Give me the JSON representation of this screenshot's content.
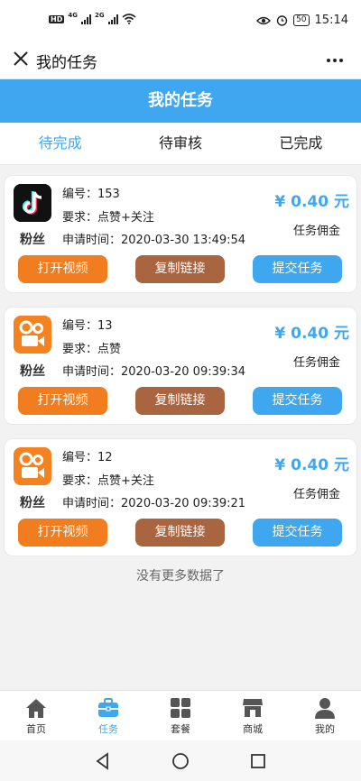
{
  "status_bar": {
    "left_badge": "HD",
    "sig1_label": "4G",
    "sig2_label": "2G",
    "battery": "50",
    "time": "15:14"
  },
  "app_header": {
    "title": "我的任务"
  },
  "page": {
    "title": "我的任务"
  },
  "tabs": [
    {
      "label": "待完成",
      "active": true
    },
    {
      "label": "待审核",
      "active": false
    },
    {
      "label": "已完成",
      "active": false
    }
  ],
  "tasks": [
    {
      "platform_label": "粉丝",
      "platform_icon": "tiktok-logo-icon",
      "number_label": "编号：153",
      "requirement_label": "要求：点赞+关注",
      "applied_label": "申请时间：2020-03-30 13:49:54",
      "price": "¥ 0.40 元",
      "commission_label": "任务佣金",
      "buttons": {
        "open": "打开视频",
        "copy": "复制链接",
        "submit": "提交任务"
      }
    },
    {
      "platform_label": "粉丝",
      "platform_icon": "kuaishou-logo-icon",
      "number_label": "编号：13",
      "requirement_label": "要求：点赞",
      "applied_label": "申请时间：2020-03-20 09:39:34",
      "price": "¥ 0.40 元",
      "commission_label": "任务佣金",
      "buttons": {
        "open": "打开视频",
        "copy": "复制链接",
        "submit": "提交任务"
      }
    },
    {
      "platform_label": "粉丝",
      "platform_icon": "kuaishou-logo-icon",
      "number_label": "编号：12",
      "requirement_label": "要求：点赞+关注",
      "applied_label": "申请时间：2020-03-20 09:39:21",
      "price": "¥ 0.40 元",
      "commission_label": "任务佣金",
      "buttons": {
        "open": "打开视频",
        "copy": "复制链接",
        "submit": "提交任务"
      }
    }
  ],
  "no_more": "没有更多数据了",
  "bottom_nav": [
    {
      "label": "首页",
      "icon": "home-icon",
      "active": false
    },
    {
      "label": "任务",
      "icon": "briefcase-icon",
      "active": true
    },
    {
      "label": "套餐",
      "icon": "grid-icon",
      "active": false
    },
    {
      "label": "商城",
      "icon": "store-icon",
      "active": false
    },
    {
      "label": "我的",
      "icon": "user-icon",
      "active": false
    }
  ],
  "colors": {
    "accent": "#3ea7ef",
    "open_button": "#f17d1e",
    "copy_button": "#a96440",
    "kuaishou_orange": "#f58220"
  }
}
